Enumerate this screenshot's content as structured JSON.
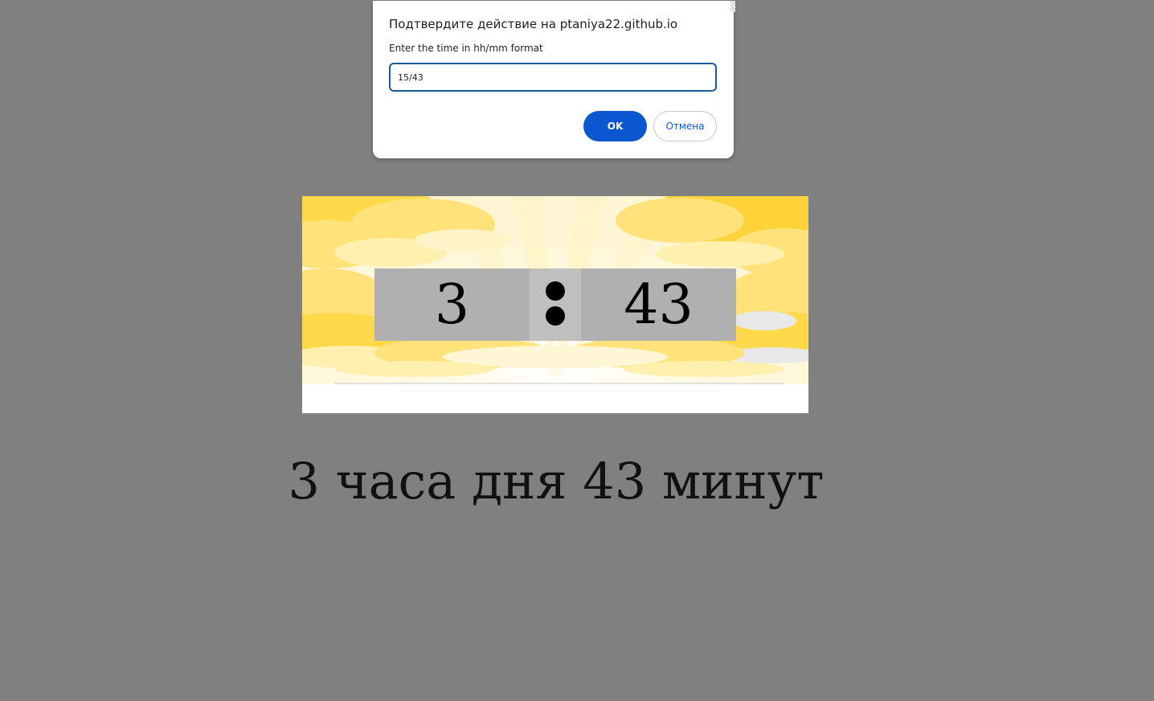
{
  "dialog": {
    "title": "Подтвердите действие на ptaniya22.github.io",
    "message": "Enter the time in hh/mm format",
    "input_value": "15/43",
    "ok_label": "OK",
    "cancel_label": "Отмена",
    "accent_color": "#0b57d0"
  },
  "clock": {
    "hours": "3",
    "minutes": "43",
    "separator_icon": "colon-dots-icon",
    "background_image": "sunrise-clouds-illustration"
  },
  "phrase": {
    "text": "3 часа дня 43 минут"
  },
  "colors": {
    "page_background": "#808080",
    "clock_box": "#b0b0b0"
  }
}
